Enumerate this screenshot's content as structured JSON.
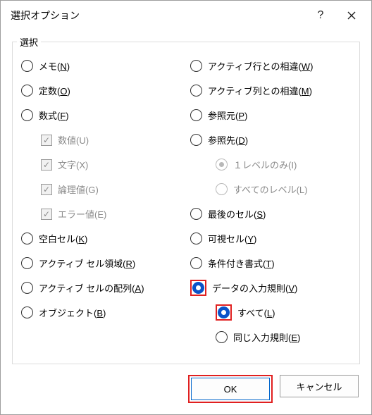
{
  "title": "選択オプション",
  "group_label": "選択",
  "left": {
    "memo": {
      "pre": "メモ(",
      "u": "N",
      "post": ")"
    },
    "constants": {
      "pre": "定数(",
      "u": "O",
      "post": ")"
    },
    "formulas": {
      "pre": "数式(",
      "u": "F",
      "post": ")"
    },
    "numbers": {
      "pre": "数値(U)",
      "u": "",
      "post": ""
    },
    "text": {
      "pre": "文字(X)",
      "u": "",
      "post": ""
    },
    "logical": {
      "pre": "論理値(G)",
      "u": "",
      "post": ""
    },
    "errors": {
      "pre": "エラー値(E)",
      "u": "",
      "post": ""
    },
    "blanks": {
      "pre": "空白セル(",
      "u": "K",
      "post": ")"
    },
    "region": {
      "pre": "アクティブ セル領域(",
      "u": "R",
      "post": ")"
    },
    "array": {
      "pre": "アクティブ セルの配列(",
      "u": "A",
      "post": ")"
    },
    "objects": {
      "pre": "オブジェクト(",
      "u": "B",
      "post": ")"
    }
  },
  "right": {
    "rowdiff": {
      "pre": "アクティブ行との相違(",
      "u": "W",
      "post": ")"
    },
    "coldiff": {
      "pre": "アクティブ列との相違(",
      "u": "M",
      "post": ")"
    },
    "precedents": {
      "pre": "参照元(",
      "u": "P",
      "post": ")"
    },
    "dependents": {
      "pre": "参照先(",
      "u": "D",
      "post": ")"
    },
    "onelevel": {
      "pre": "１レベルのみ(I)",
      "u": "",
      "post": ""
    },
    "alllevels": {
      "pre": "すべてのレベル(L)",
      "u": "",
      "post": ""
    },
    "lastcell": {
      "pre": "最後のセル(",
      "u": "S",
      "post": ")"
    },
    "visible": {
      "pre": "可視セル(",
      "u": "Y",
      "post": ")"
    },
    "condfmt": {
      "pre": "条件付き書式(",
      "u": "T",
      "post": ")"
    },
    "validation": {
      "pre": "データの入力規則(",
      "u": "V",
      "post": ")"
    },
    "all": {
      "pre": "すべて(",
      "u": "L",
      "post": ")"
    },
    "same": {
      "pre": "同じ入力規則(",
      "u": "E",
      "post": ")"
    }
  },
  "buttons": {
    "ok": "OK",
    "cancel": "キャンセル"
  }
}
